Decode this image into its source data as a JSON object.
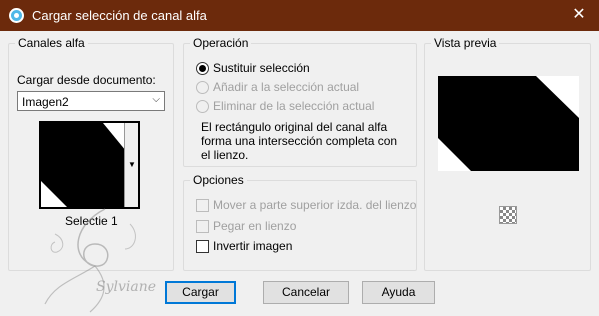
{
  "window": {
    "title": "Cargar selección de canal alfa",
    "close_glyph": "✕"
  },
  "left_panel": {
    "legend": "Canales alfa",
    "load_label": "Cargar desde documento:",
    "document_select": {
      "value": "Imagen2"
    },
    "thumbnail_caption": "Selectie 1"
  },
  "operation": {
    "legend": "Operación",
    "options": [
      {
        "label": "Sustituir selección",
        "checked": true,
        "enabled": true
      },
      {
        "label": "Añadir a la selección actual",
        "checked": false,
        "enabled": false
      },
      {
        "label": "Eliminar de la selección actual",
        "checked": false,
        "enabled": false
      }
    ],
    "description_lines": [
      "El rectángulo original del canal alfa",
      "forma una intersección completa con",
      "el lienzo."
    ]
  },
  "options": {
    "legend": "Opciones",
    "items": [
      {
        "label": "Mover a parte superior izda. del lienzo",
        "checked": false,
        "enabled": false
      },
      {
        "label": "Pegar en lienzo",
        "checked": false,
        "enabled": false
      },
      {
        "label": "Invertir imagen",
        "checked": false,
        "enabled": true
      }
    ]
  },
  "preview": {
    "legend": "Vista previa",
    "zoom_icon": "checker-icon"
  },
  "buttons": {
    "load": "Cargar",
    "cancel": "Cancelar",
    "help": "Ayuda"
  },
  "watermark": {
    "text": "Sylviane"
  },
  "colors": {
    "titlebar": "#6c2a0c",
    "accent": "#0078d7"
  }
}
